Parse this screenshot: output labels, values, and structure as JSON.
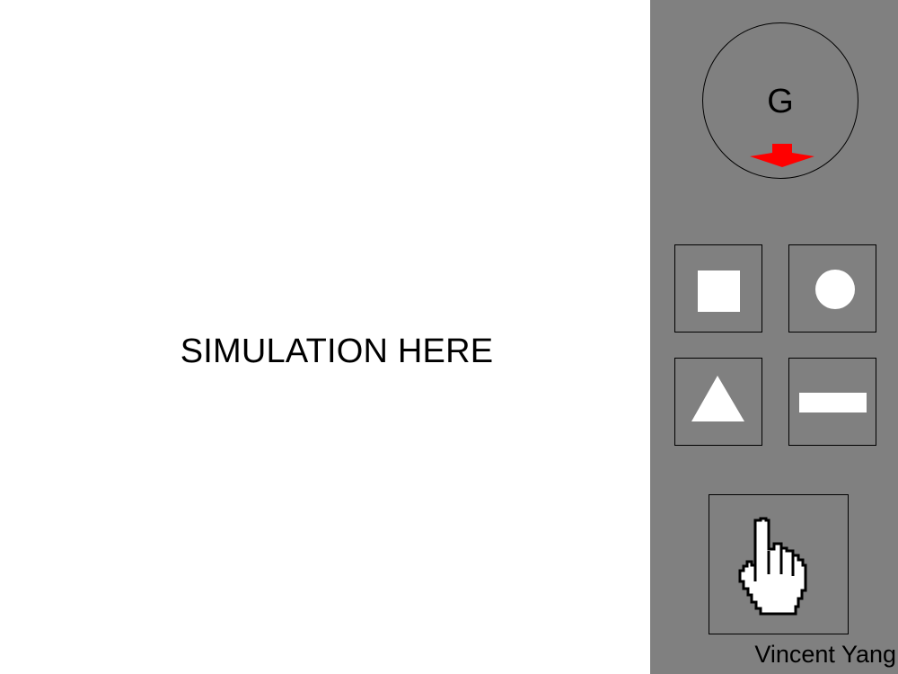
{
  "simulation": {
    "placeholder_text": "SIMULATION HERE"
  },
  "sidebar": {
    "gravity": {
      "label": "G",
      "icon": "down-arrow-icon",
      "arrow_color": "#ff0000"
    },
    "tools": [
      {
        "icon": "square-icon"
      },
      {
        "icon": "circle-icon"
      },
      {
        "icon": "triangle-icon"
      },
      {
        "icon": "bar-icon"
      }
    ],
    "hand_tool": {
      "icon": "hand-pointer-icon"
    },
    "author": "Vincent Yang"
  },
  "colors": {
    "sidebar_bg": "#808080",
    "shape_fill": "#ffffff",
    "border": "#000000"
  }
}
